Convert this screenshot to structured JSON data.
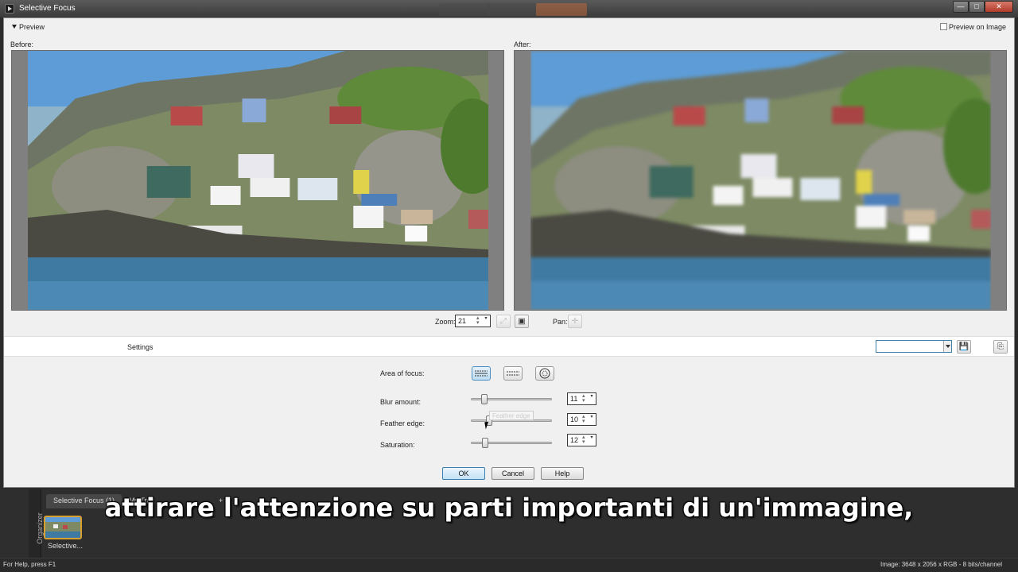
{
  "window": {
    "title": "Selective Focus",
    "controls": {
      "minimize": "—",
      "maximize": "□",
      "close": "✕"
    }
  },
  "preview": {
    "header": "Preview",
    "preview_on_image": "Preview on Image",
    "before_label": "Before:",
    "after_label": "After:",
    "zoom_label": "Zoom:",
    "zoom_value": "21",
    "pan_label": "Pan:"
  },
  "settings": {
    "label": "Settings",
    "preset_value": "",
    "area_of_focus_label": "Area of focus:",
    "blur_amount_label": "Blur amount:",
    "blur_amount_value": "11",
    "feather_edge_label": "Feather edge:",
    "feather_edge_value": "10",
    "saturation_label": "Saturation:",
    "saturation_value": "12",
    "tooltip": "Feather edge",
    "slider_levels": {
      "blur": 0.13,
      "feather": 0.2,
      "saturation": 0.14
    }
  },
  "buttons": {
    "ok": "OK",
    "cancel": "Cancel",
    "help": "Help"
  },
  "organizer": {
    "side_label": "Organizer",
    "tabs": [
      "Selective Focus (1)",
      "My Tray",
      "+"
    ],
    "thumb_caption": "Selective..."
  },
  "subtitle": "attirare l'attenzione su parti importanti di un'immagine,",
  "status": {
    "help": "For Help, press F1",
    "image_info": "Image:  3648 x 2056 x RGB - 8 bits/channel"
  },
  "colors": {
    "accent": "#3c7fb1",
    "thumb_border": "#d8a030",
    "title_bar": "#3a3a3a"
  }
}
